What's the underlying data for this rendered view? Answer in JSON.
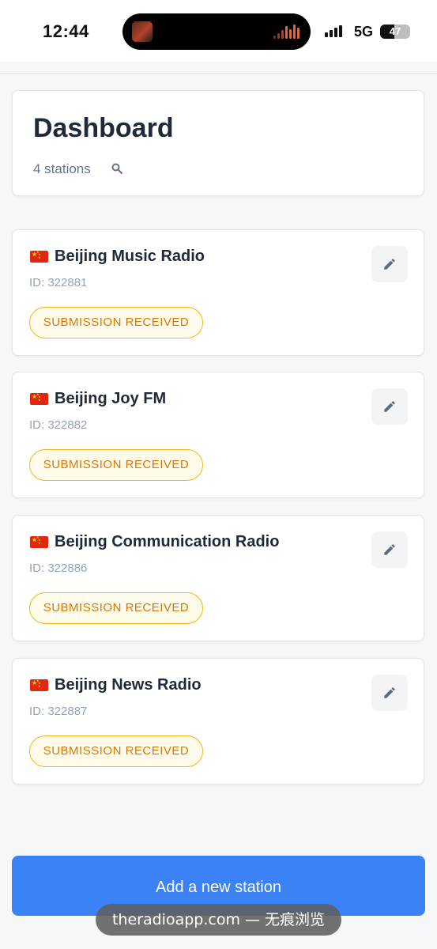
{
  "status_bar": {
    "time": "12:44",
    "network": "5G",
    "battery": "47",
    "battery_level": 0.47
  },
  "dashboard": {
    "title": "Dashboard",
    "count_label": "4 stations"
  },
  "stations": [
    {
      "name": "Beijing Music Radio",
      "id": "ID: 322881",
      "status": "SUBMISSION RECEIVED"
    },
    {
      "name": "Beijing Joy FM",
      "id": "ID: 322882",
      "status": "SUBMISSION RECEIVED"
    },
    {
      "name": "Beijing Communication Radio",
      "id": "ID: 322886",
      "status": "SUBMISSION RECEIVED"
    },
    {
      "name": "Beijing News Radio",
      "id": "ID: 322887",
      "status": "SUBMISSION RECEIVED"
    }
  ],
  "add_button": {
    "label": "Add a new station"
  },
  "browser": {
    "url": "theradioapp.com — 无痕浏览"
  },
  "colors": {
    "accent": "#3b82f6",
    "badge_text": "#d97706",
    "badge_border": "#f2b61b",
    "flag_red": "#de2910"
  },
  "icons": {
    "edit": "pencil-icon",
    "search": "search-icon",
    "flag": "china-flag-icon"
  }
}
